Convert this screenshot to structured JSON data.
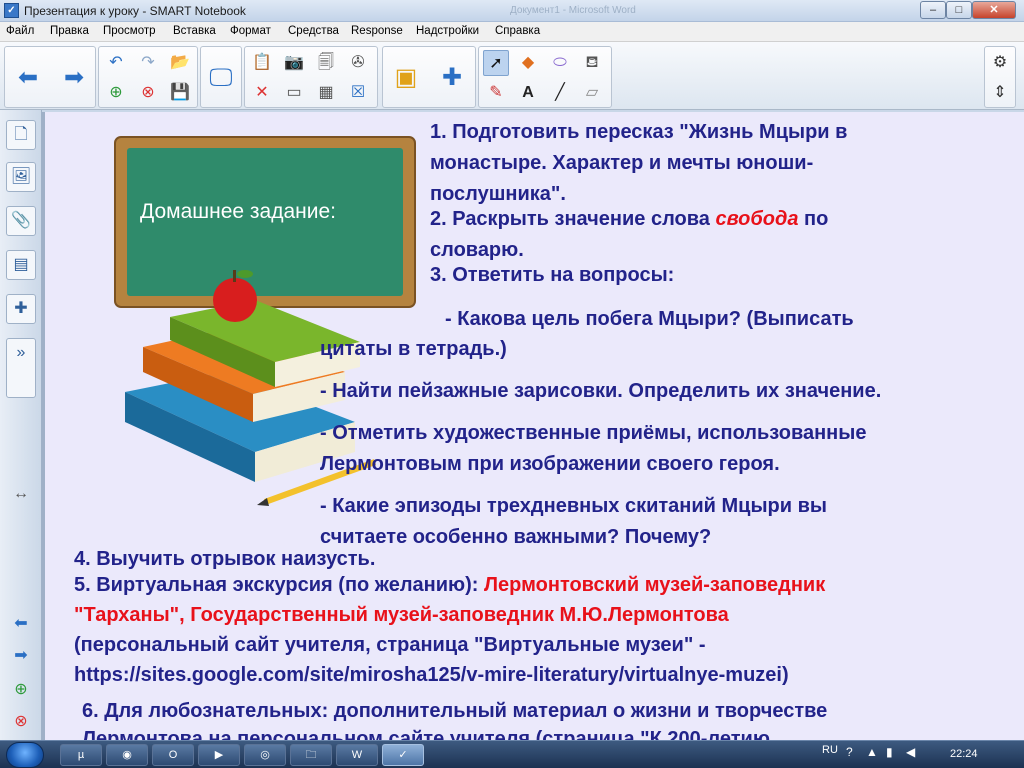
{
  "window": {
    "title": "Презентация к уроку - SMART Notebook",
    "ghost_title": "Документ1 - Microsoft Word",
    "minimize": "–",
    "maximize": "□",
    "close": "✕"
  },
  "menu": [
    "Файл",
    "Правка",
    "Просмотр",
    "Вставка",
    "Формат",
    "Средства",
    "Response",
    "Надстройки",
    "Справка"
  ],
  "slide": {
    "board_caption": "Домашнее задание:",
    "lines": {
      "l1a": "1. Подготовить пересказ \"Жизнь Мцыри в",
      "l1b": "монастыре. Характер и мечты юноши-",
      "l1c": "послушника\".",
      "l2a_pre": "2. Раскрыть значение слова ",
      "l2a_word": "свобода",
      "l2a_post": " по",
      "l2b": "словарю.",
      "l3": "3. Ответить на вопросы:",
      "q1a": "- Какова цель побега Мцыри? (Выписать",
      "q1b": "цитаты в тетрадь.)",
      "q2": "- Найти пейзажные зарисовки. Определить их значение.",
      "q3a": "- Отметить художественные приёмы, использованные",
      "q3b": "Лермонтовым при изображении своего героя.",
      "q4a": "- Какие эпизоды трехдневных скитаний Мцыри вы",
      "q4b": "считаете особенно важными? Почему?",
      "l4": "4. Выучить отрывок наизусть.",
      "l5a_pre": "5. Виртуальная экскурсия (по желанию): ",
      "l5a_red": "Лермонтовский музей-заповедник",
      "l5b": "\"Тарханы\", Государственный музей-заповедник М.Ю.Лермонтова",
      "l5c": "(персональный сайт учителя, страница \"Виртуальные музеи\" -",
      "l5d": "https://sites.google.com/site/mirosha125/v-mire-literatury/virtualnye-muzei)",
      "l6": "6. Для любознательных: дополнительный материал о жизни и творчестве",
      "l7": "Лермонтова на персональном сайте учителя (страница \"К 200-летию"
    }
  },
  "taskbar": {
    "lang": "RU",
    "clock": "22:24",
    "word_label": "W"
  }
}
